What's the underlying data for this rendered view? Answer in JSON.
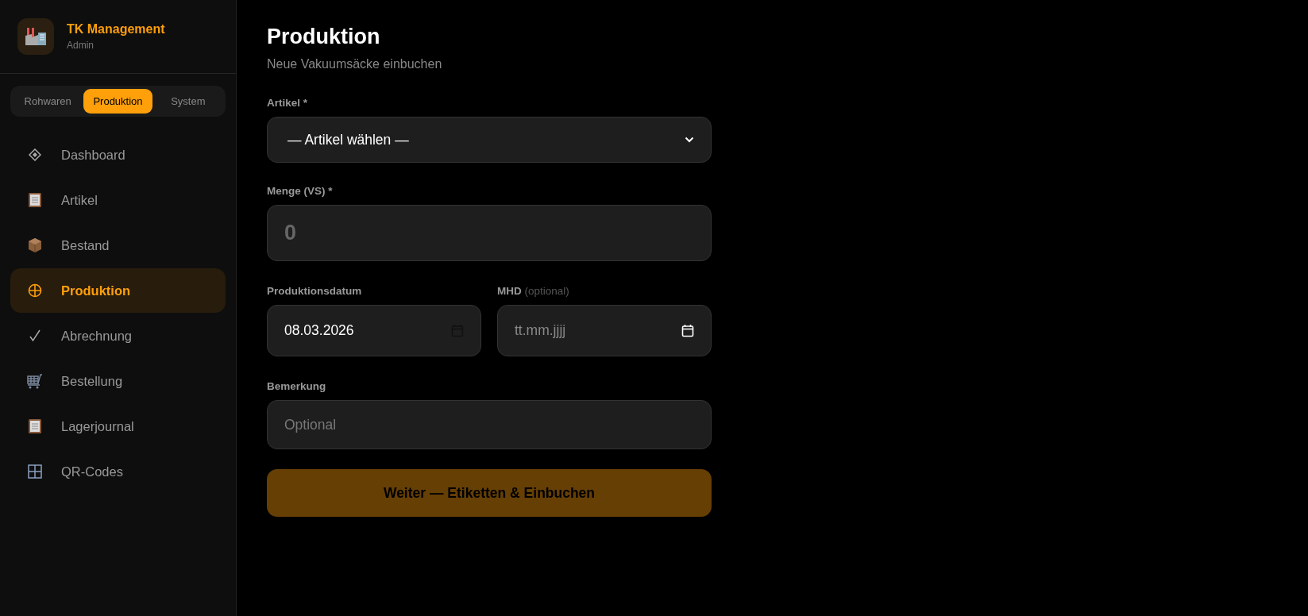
{
  "brand": {
    "title": "TK Management",
    "role": "Admin"
  },
  "mode_tabs": [
    {
      "label": "Rohwaren",
      "selected": false
    },
    {
      "label": "Produktion",
      "selected": true
    },
    {
      "label": "System",
      "selected": false
    }
  ],
  "nav": [
    {
      "label": "Dashboard",
      "selected": false
    },
    {
      "label": "Artikel",
      "selected": false
    },
    {
      "label": "Bestand",
      "selected": false
    },
    {
      "label": "Produktion",
      "selected": true
    },
    {
      "label": "Abrechnung",
      "selected": false
    },
    {
      "label": "Bestellung",
      "selected": false
    },
    {
      "label": "Lagerjournal",
      "selected": false
    },
    {
      "label": "QR-Codes",
      "selected": false
    }
  ],
  "page": {
    "title": "Produktion",
    "subtitle": "Neue Vakuumsäcke einbuchen"
  },
  "form": {
    "article": {
      "label": "Artikel *",
      "value": "— Artikel wählen —"
    },
    "quantity": {
      "label": "Menge (VS) *",
      "placeholder": "0"
    },
    "production_date": {
      "label": "Produktionsdatum",
      "value": "08.03.2026"
    },
    "best_before": {
      "label": "MHD",
      "hint": "(optional)",
      "placeholder": "tt.mm.jjjj"
    },
    "remark": {
      "label": "Bemerkung",
      "placeholder": "Optional"
    },
    "submit": {
      "label": "Weiter — Etiketten & Einbuchen",
      "disabled": true
    }
  }
}
